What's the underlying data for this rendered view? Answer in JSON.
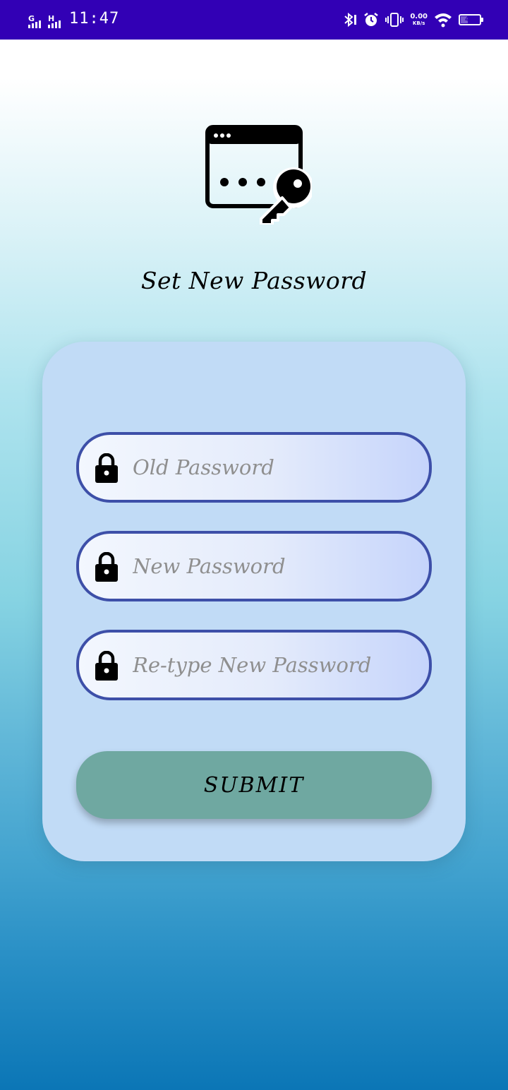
{
  "status_bar": {
    "time": "11:47",
    "network_1": "G",
    "network_2": "H",
    "net_speed": "0.00",
    "net_speed_unit": "KB/s",
    "battery_level": "43",
    "background_color": "#3200b5"
  },
  "page": {
    "title": "Set New Password",
    "hero_icon": "browser-password-key-icon"
  },
  "form": {
    "old_password_placeholder": "Old Password",
    "new_password_placeholder": "New Password",
    "retype_password_placeholder": "Re-type New Password",
    "submit_label": "SUBMIT",
    "field_icon": "lock-icon"
  },
  "colors": {
    "card": "#c1dbf6",
    "field_border": "#3d4fa8",
    "submit_button": "#6fa8a1",
    "status_bar": "#3200b5"
  }
}
